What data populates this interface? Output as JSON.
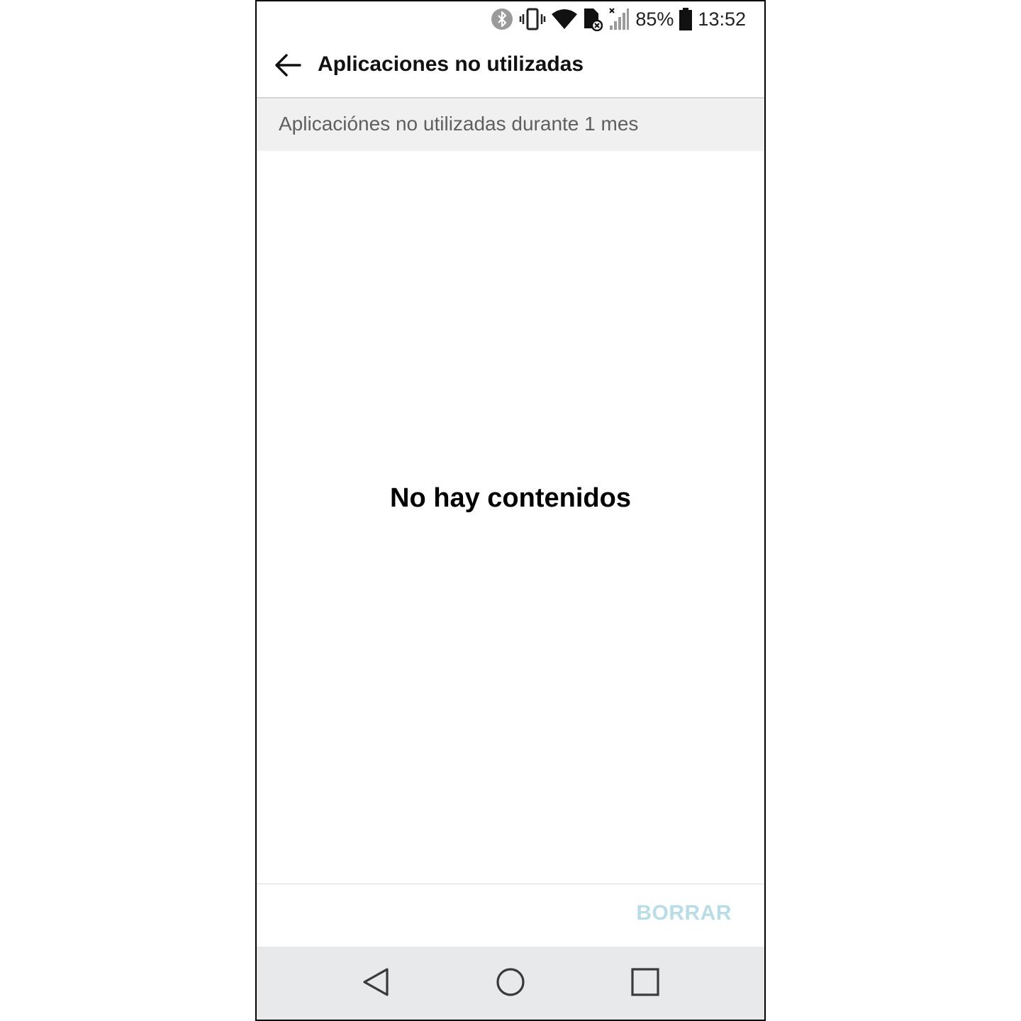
{
  "status_bar": {
    "battery_percent": "85%",
    "time": "13:52",
    "icons": [
      "bluetooth-icon",
      "vibrate-icon",
      "wifi-icon",
      "no-sim-icon",
      "signal-icon",
      "battery-icon"
    ]
  },
  "app_bar": {
    "title": "Aplicaciones no utilizadas",
    "back_icon": "arrow-left-icon"
  },
  "subheader": {
    "text": "Aplicaciónes no utilizadas durante 1 mes"
  },
  "empty_state": {
    "text": "No hay contenidos"
  },
  "actions": {
    "clear_label": "BORRAR",
    "clear_color": "#b8dde6"
  },
  "nav_bar": {
    "buttons": [
      "back-icon",
      "home-icon",
      "recents-icon"
    ]
  }
}
